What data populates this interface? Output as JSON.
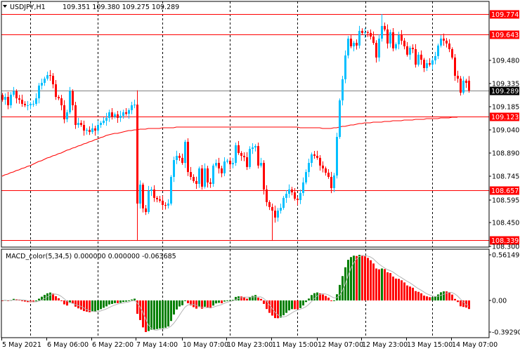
{
  "header": {
    "symbol": "USDJPY,H1",
    "ohlc": "109.351 109.380 109.275 109.289"
  },
  "colors": {
    "bull": "#00bfff",
    "bear": "#ff0000",
    "level": "#ff0000",
    "ma": "#ff0000",
    "macd_up": "#008000",
    "macd_down": "#ff0000",
    "signal": "#b4b4b4",
    "bid": "#808080"
  },
  "chart_data": {
    "type": "candlestick",
    "symbol": "USDJPY",
    "timeframe": "H1",
    "ylim": [
      108.3,
      109.8
    ],
    "y_ticks": [
      "109.480",
      "109.335",
      "109.185",
      "109.040",
      "108.890",
      "108.745",
      "108.595",
      "108.450",
      "108.300"
    ],
    "y_tick_values": [
      109.48,
      109.335,
      109.185,
      109.04,
      108.89,
      108.745,
      108.595,
      108.45,
      108.3
    ],
    "levels": [
      {
        "value": 109.774,
        "label": "109.774"
      },
      {
        "value": 109.643,
        "label": "109.643"
      },
      {
        "value": 109.123,
        "label": "109.123"
      },
      {
        "value": 108.657,
        "label": "108.657"
      },
      {
        "value": 108.339,
        "label": "108.339"
      }
    ],
    "bid": {
      "value": 109.289,
      "label": "109.289"
    },
    "first_open": 109.26,
    "last_candle": {
      "open": 109.351,
      "high": 109.38,
      "low": 109.275,
      "close": 109.289
    },
    "closes": [
      109.23,
      109.248,
      109.195,
      109.262,
      109.284,
      109.239,
      109.23,
      109.204,
      109.195,
      109.195,
      109.204,
      109.204,
      109.239,
      109.32,
      109.337,
      109.364,
      109.386,
      109.382,
      109.328,
      109.248,
      109.239,
      109.195,
      109.106,
      109.15,
      109.284,
      109.195,
      109.07,
      109.083,
      109.07,
      109.034,
      109.039,
      109.025,
      109.048,
      109.034,
      109.07,
      109.083,
      109.097,
      109.115,
      109.15,
      109.123,
      109.137,
      109.115,
      109.128,
      109.15,
      109.141,
      109.164,
      109.195,
      109.199,
      108.571,
      108.691,
      108.54,
      108.517,
      108.651,
      108.66,
      108.607,
      108.598,
      108.589,
      108.562,
      108.558,
      108.571,
      108.74,
      108.847,
      108.874,
      108.861,
      108.829,
      108.963,
      108.771,
      108.74,
      108.714,
      108.696,
      108.794,
      108.678,
      108.794,
      108.705,
      108.696,
      108.812,
      108.829,
      108.794,
      108.763,
      108.838,
      108.843,
      108.82,
      108.829,
      108.941,
      108.892,
      108.874,
      108.865,
      108.803,
      108.918,
      108.927,
      108.936,
      108.812,
      108.829,
      108.66,
      108.58,
      108.549,
      108.526,
      108.482,
      108.526,
      108.544,
      108.607,
      108.633,
      108.66,
      108.642,
      108.602,
      108.593,
      108.638,
      108.705,
      108.771,
      108.829,
      108.883,
      108.874,
      108.861,
      108.812,
      108.794,
      108.767,
      108.74,
      108.669,
      108.749,
      108.994,
      109.226,
      109.36,
      109.511,
      109.618,
      109.569,
      109.591,
      109.574,
      109.667,
      109.654,
      109.658,
      109.654,
      109.631,
      109.591,
      109.498,
      109.618,
      109.698,
      109.676,
      109.587,
      109.658,
      109.556,
      109.582,
      109.64,
      109.605,
      109.569,
      109.516,
      109.56,
      109.551,
      109.453,
      109.516,
      109.484,
      109.431,
      109.462,
      109.453,
      109.48,
      109.507,
      109.574,
      109.618,
      109.605,
      109.587,
      109.551,
      109.498,
      109.382,
      109.364,
      109.275,
      109.351,
      109.337,
      109.289
    ],
    "extreme_wicks": [
      {
        "index": 48,
        "high": 109.29,
        "low": 108.339
      },
      {
        "index": 96,
        "low": 108.339
      },
      {
        "index": 135,
        "high": 109.774
      }
    ],
    "moving_average": [
      [
        0,
        108.745
      ],
      [
        10,
        108.812
      ],
      [
        16,
        108.86
      ],
      [
        24,
        108.914
      ],
      [
        37,
        109.003
      ],
      [
        44,
        109.03
      ],
      [
        49,
        109.043
      ],
      [
        65,
        109.057
      ],
      [
        100,
        109.057
      ],
      [
        117,
        109.048
      ],
      [
        129,
        109.083
      ],
      [
        149,
        109.106
      ],
      [
        162,
        109.119
      ]
    ],
    "x_labels": [
      "5 May 2021",
      "6 May 06:00",
      "6 May 22:00",
      "7 May 14:00",
      "10 May 07:00",
      "10 May 23:00",
      "11 May 15:00",
      "12 May 07:00",
      "12 May 23:00",
      "13 May 15:00",
      "14 May 07:00"
    ],
    "macd": {
      "title": "MACD_color(5,34,5) 0.000000 0.000000 -0.063685",
      "fast": 5,
      "slow": 34,
      "signal": 5,
      "ylim": [
        -0.392902,
        0.561493
      ],
      "y_ticks": [
        "0.561493",
        "0.00",
        "-0.392902"
      ]
    }
  }
}
